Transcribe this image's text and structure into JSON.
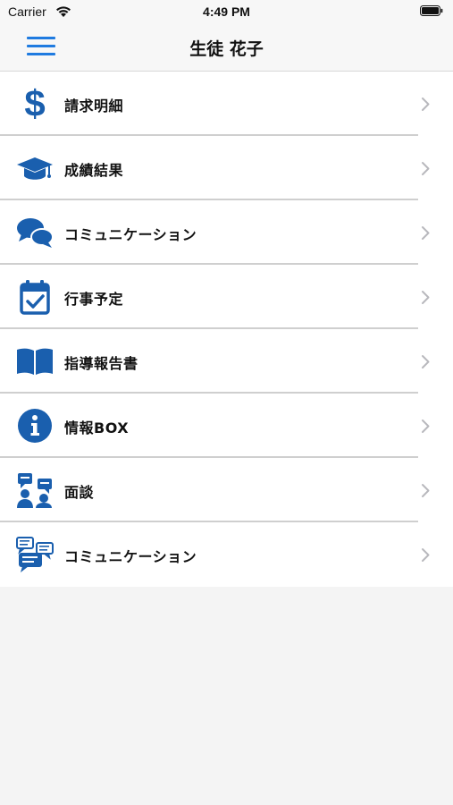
{
  "status_bar": {
    "carrier": "Carrier",
    "time": "4:49 PM"
  },
  "header": {
    "title": "生徒 花子"
  },
  "menu": {
    "items": [
      {
        "label": "請求明細",
        "icon": "dollar-icon"
      },
      {
        "label": "成績結果",
        "icon": "graduation-cap-icon"
      },
      {
        "label": "コミュニケーション",
        "icon": "chat-bubbles-icon"
      },
      {
        "label": "行事予定",
        "icon": "calendar-check-icon"
      },
      {
        "label": "指導報告書",
        "icon": "open-book-icon"
      },
      {
        "label": "情報BOX",
        "icon": "info-icon"
      },
      {
        "label": "面談",
        "icon": "meeting-icon"
      },
      {
        "label": "コミュニケーション",
        "icon": "message-bubbles-icon"
      }
    ]
  },
  "colors": {
    "accent": "#1f7be0",
    "icon": "#1a5fae",
    "chevron": "#b8b8bd"
  }
}
